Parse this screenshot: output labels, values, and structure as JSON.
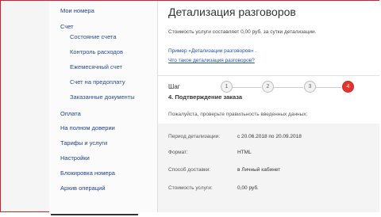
{
  "sidebar": {
    "items": [
      {
        "label": "Мои номера"
      },
      {
        "label": "Счет"
      },
      {
        "label": "Состояние счета"
      },
      {
        "label": "Контроль расходов"
      },
      {
        "label": "Ежемесячный счет"
      },
      {
        "label": "Счет на предоплату"
      },
      {
        "label": "Заказанные документы"
      },
      {
        "label": "Оплата"
      },
      {
        "label": "На полном доверии"
      },
      {
        "label": "Тарифы и услуги"
      },
      {
        "label": "Настройки"
      },
      {
        "label": "Блокировка номера"
      },
      {
        "label": "Архив операций"
      }
    ]
  },
  "main": {
    "title": "Детализация разговоров",
    "cost_text": "Стоимость услуги составляет 0,00 руб. за сутки детализации.",
    "example_link": "Пример «Детализации разговоров» .",
    "what_is_link": "Что такое детализация разговоров?",
    "step_label": "Шаг",
    "steps": [
      "1",
      "2",
      "3",
      "4"
    ],
    "active_step": 4,
    "step_title": "4. Подтверждение заказа",
    "check_text": "Пожалуйста, проверьте правильность введенных данных:",
    "details": [
      {
        "label": "Период детализации:",
        "value": "с 20.06.2018 по 20.09.2018"
      },
      {
        "label": "Формат:",
        "value": "HTML"
      },
      {
        "label": "Способ доставки:",
        "value": "в Личный кабинет"
      },
      {
        "label": "Стоимость услуги:",
        "value": "0,00 руб."
      }
    ]
  },
  "colors": {
    "accent_red": "#e3342f",
    "link_blue": "#1e4fa5",
    "frame_red": "#d61f26"
  }
}
